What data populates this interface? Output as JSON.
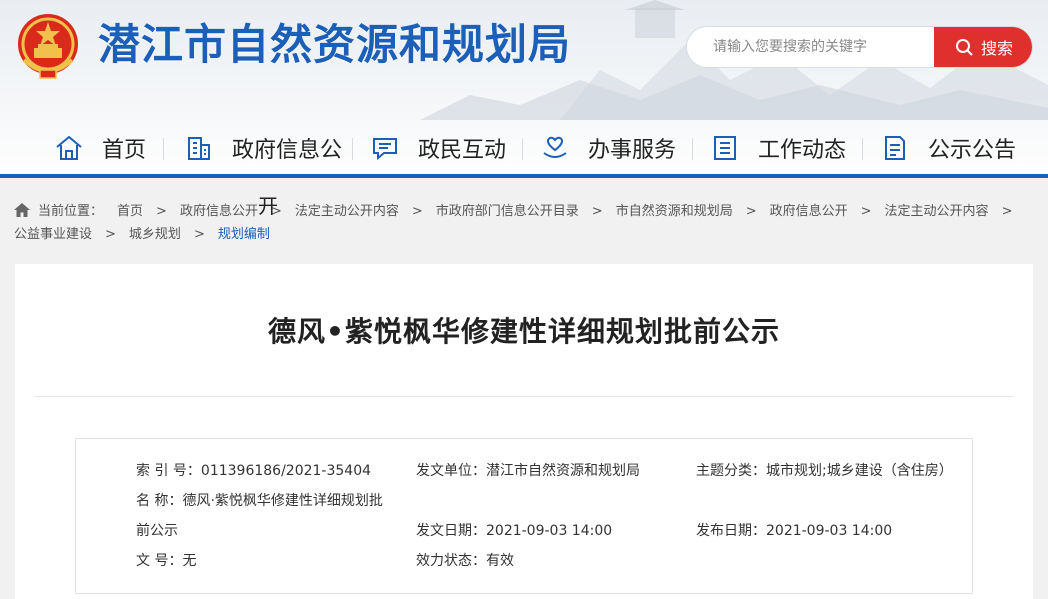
{
  "site": {
    "title": "潜江市自然资源和规划局"
  },
  "search": {
    "placeholder": "请输入您要搜索的关键字",
    "button_label": "搜索"
  },
  "nav": {
    "items": [
      {
        "label": "首页",
        "icon": "home-icon"
      },
      {
        "label": "政府信息公",
        "icon": "building-icon"
      },
      {
        "label": "政民互动",
        "icon": "chat-icon"
      },
      {
        "label": "办事服务",
        "icon": "heart-hand-icon"
      },
      {
        "label": "工作动态",
        "icon": "list-icon"
      },
      {
        "label": "公示公告",
        "icon": "document-icon"
      }
    ],
    "overflow_char": "开"
  },
  "breadcrumb": {
    "prefix": "当前位置：",
    "items": [
      "首页",
      "政府信息公开",
      "法定主动公开内容",
      "市政府部门信息公开目录",
      "市自然资源和规划局",
      "政府信息公开",
      "法定主动公开内容",
      "公益事业建设",
      "城乡规划",
      "规划编制"
    ]
  },
  "article": {
    "title": "德风•紫悦枫华修建性详细规划批前公示"
  },
  "meta": {
    "index_label": "索  引  号：",
    "index_value": "011396186/2021-35404",
    "issuer_label": "发文单位：",
    "issuer_value": "潜江市自然资源和规划局",
    "topic_label": "主题分类：",
    "topic_value": "城市规划;城乡建设（含住房）",
    "name_label": "名        称：",
    "name_value_line1": "德风·紫悦枫华修建性详细规划批",
    "name_value_line2": "前公示",
    "date_label": "发文日期：",
    "date_value": "2021-09-03 14:00",
    "publish_label": "发布日期：",
    "publish_value": "2021-09-03 14:00",
    "docno_label": "文        号：",
    "docno_value": "无",
    "status_label": "效力状态：",
    "status_value": "有效"
  },
  "colors": {
    "brand_blue": "#1c5fb8",
    "search_red": "#e0302e"
  }
}
